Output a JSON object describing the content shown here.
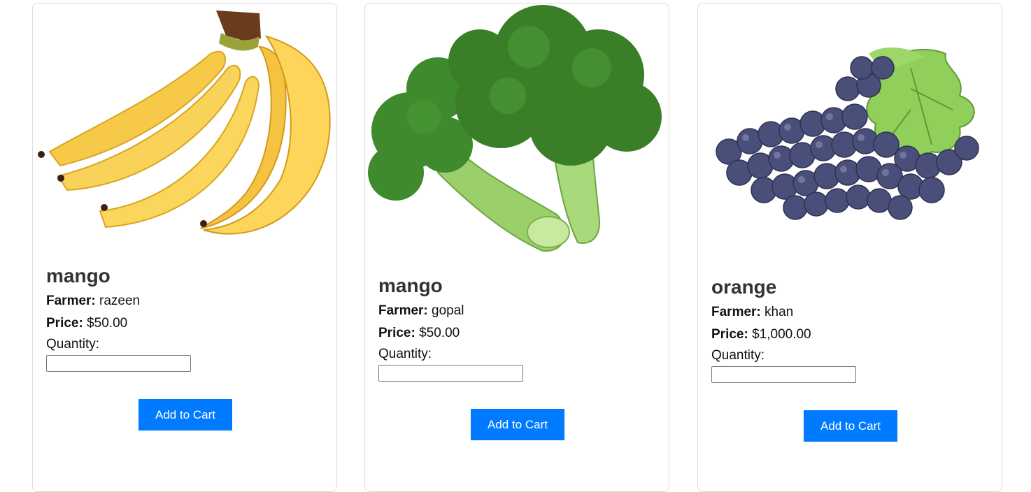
{
  "products": [
    {
      "name": "mango",
      "farmer_label": "Farmer:",
      "farmer": "razeen",
      "price_label": "Price:",
      "price": "$50.00",
      "quantity_label": "Quantity:",
      "quantity_value": "",
      "button_label": "Add to Cart",
      "image_icon": "banana-image"
    },
    {
      "name": "mango",
      "farmer_label": "Farmer:",
      "farmer": "gopal",
      "price_label": "Price:",
      "price": "$50.00",
      "quantity_label": "Quantity:",
      "quantity_value": "",
      "button_label": "Add to Cart",
      "image_icon": "broccoli-image"
    },
    {
      "name": "orange",
      "farmer_label": "Farmer:",
      "farmer": "khan",
      "price_label": "Price:",
      "price": "$1,000.00",
      "quantity_label": "Quantity:",
      "quantity_value": "",
      "button_label": "Add to Cart",
      "image_icon": "grapes-image"
    }
  ],
  "colors": {
    "button_bg": "#007bff",
    "button_text": "#ffffff",
    "card_border": "#dddddd",
    "title_text": "#333333"
  }
}
